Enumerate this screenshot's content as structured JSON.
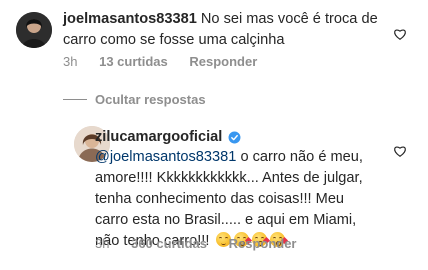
{
  "comments": [
    {
      "username": "joelmasantos83381",
      "text": "No sei mas você é troca de carro como se fosse uma calçinha",
      "time": "3h",
      "likes": "13 curtidas",
      "reply": "Responder"
    }
  ],
  "hide_replies": "Ocultar respostas",
  "reply": {
    "username": "zilucamargooficial",
    "lines": [
      {
        "mention": "@joelmasantos83381",
        "text": " o carro não é meu,"
      },
      {
        "text": "amore!!!! Kkkkkkkkkkkk... Antes de julgar,"
      },
      {
        "text": "tenha conhecimento das coisas!!! Meu"
      },
      {
        "text": "carro esta no Brasil..... e aqui em Miami,"
      },
      {
        "text": "não tenho carro!!! "
      }
    ],
    "emojis": [
      "smile-emoji",
      "kiss-emoji",
      "kiss-emoji",
      "kiss-emoji"
    ],
    "time": "3h",
    "likes": "360 curtidas",
    "reply_label": "Responder"
  },
  "icons": {
    "like": "heart-outline-icon",
    "verified": "verified-badge-icon"
  },
  "colors": {
    "text": "#262626",
    "meta": "#8e8e8e",
    "mention": "#00376b",
    "verified": "#3897f0"
  }
}
